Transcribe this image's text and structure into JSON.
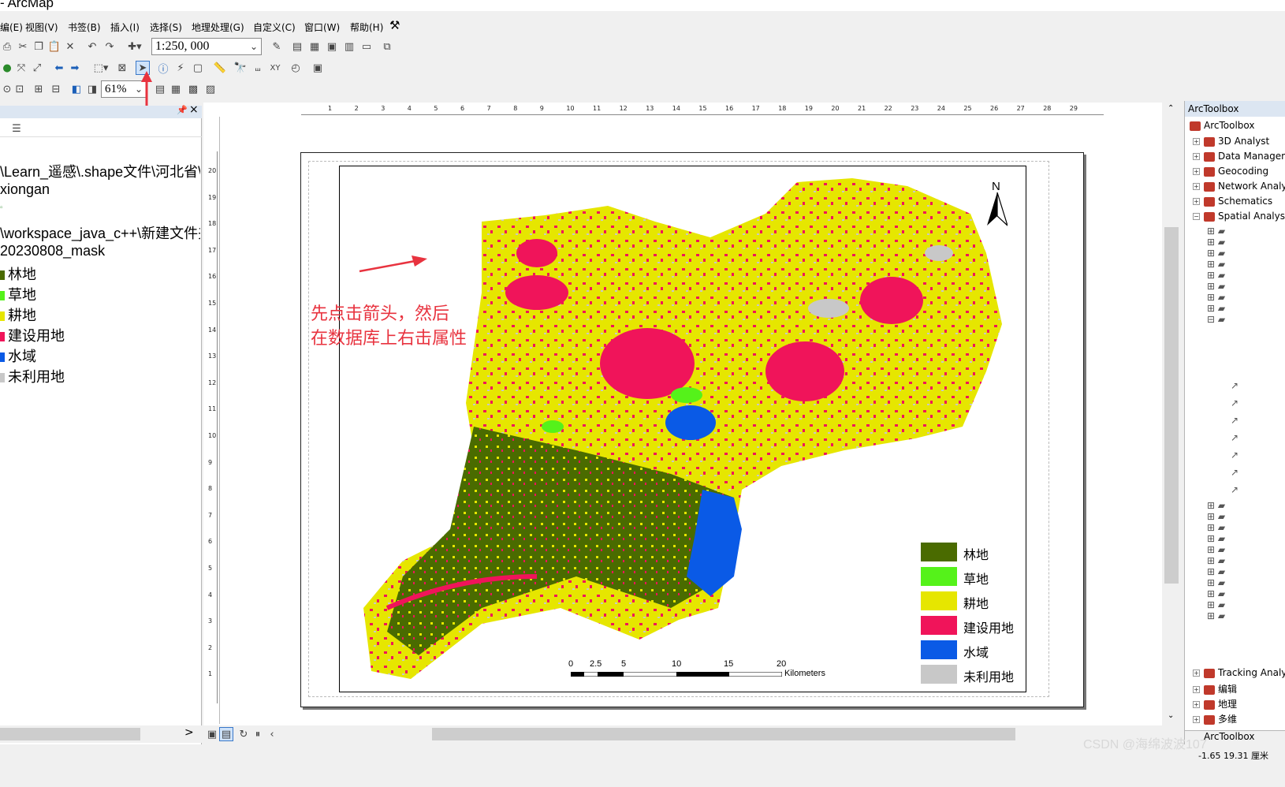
{
  "window": {
    "title": "- ArcMap"
  },
  "menu": [
    "编(E)",
    "视图(V)",
    "书签(B)",
    "插入(I)",
    "选择(S)",
    "地理处理(G)",
    "自定义(C)",
    "窗口(W)",
    "帮助(H)"
  ],
  "toolbar": {
    "scale_value": "1:250, 000",
    "zoom_value": "61%"
  },
  "toc": {
    "rows": [
      "\\Learn_遥感\\.shape文件\\河北省\\雄",
      "xiongan",
      "",
      "\\workspace_java_c++\\新建文件夹",
      "20230808_mask",
      "林地",
      "草地",
      "耕地",
      "建设用地",
      "水域",
      "未利用地"
    ]
  },
  "ruler_top": [
    "1",
    "2",
    "3",
    "4",
    "5",
    "6",
    "7",
    "8",
    "9",
    "10",
    "11",
    "12",
    "13",
    "14",
    "15",
    "16",
    "17",
    "18",
    "19",
    "20",
    "21",
    "22",
    "23",
    "24",
    "25",
    "26",
    "27",
    "28",
    "29"
  ],
  "ruler_left": [
    "20",
    "19",
    "18",
    "17",
    "16",
    "15",
    "14",
    "13",
    "12",
    "11",
    "10",
    "9",
    "8",
    "7",
    "6",
    "5",
    "4",
    "3",
    "2",
    "1"
  ],
  "map": {
    "north_label": "N",
    "legend": [
      {
        "label": "林地",
        "color": "#4a6b00"
      },
      {
        "label": "草地",
        "color": "#55f21a"
      },
      {
        "label": "耕地",
        "color": "#e6e600"
      },
      {
        "label": "建设用地",
        "color": "#f0145a"
      },
      {
        "label": "水域",
        "color": "#0a5ae6"
      },
      {
        "label": "未利用地",
        "color": "#c8c8c8"
      }
    ],
    "scale_ticks": [
      "0",
      "2.5",
      "5",
      "10",
      "15",
      "20"
    ],
    "scale_unit": "Kilometers"
  },
  "annotation": {
    "line1": "先点击箭头，然后",
    "line2": "在数据库上右击属性",
    "color": "#e8333f"
  },
  "toolbox": {
    "header": "ArcToolbox",
    "items": [
      "ArcToolbox",
      "3D Analyst",
      "Data Management",
      "Geocoding",
      "Network Analyst",
      "Schematics",
      "Spatial Analyst",
      "Tracking Analyst",
      "编辑",
      "地理",
      "多维"
    ],
    "tab": "ArcToolbox"
  },
  "status": {
    "coords": "-1.65  19.31 厘米"
  },
  "watermark": "CSDN @海绵波波107"
}
